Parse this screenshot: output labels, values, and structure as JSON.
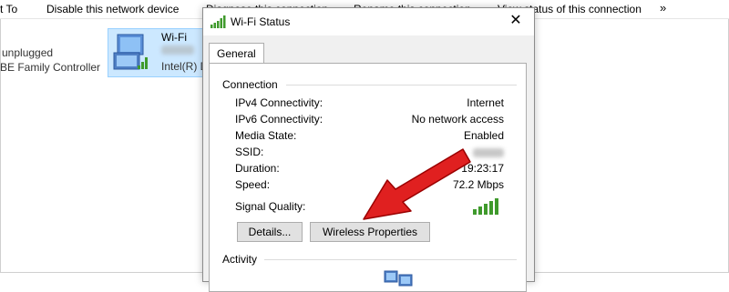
{
  "toolbar": {
    "items": [
      "t To",
      "Disable this network device",
      "Diagnose this connection",
      "Rename this connection",
      "View status of this connection"
    ],
    "more": "»"
  },
  "background": {
    "adapter_left": {
      "status": "unplugged",
      "device": "BE Family Controller"
    },
    "wifi_adapter": {
      "name": "Wi-Fi",
      "device": "Intel(R) D"
    }
  },
  "dialog": {
    "title": "Wi-Fi Status",
    "close": "✕",
    "tab": "General",
    "connection": {
      "label": "Connection",
      "rows": [
        {
          "label": "IPv4 Connectivity:",
          "value": "Internet"
        },
        {
          "label": "IPv6 Connectivity:",
          "value": "No network access"
        },
        {
          "label": "Media State:",
          "value": "Enabled"
        },
        {
          "label": "SSID:",
          "value": ""
        },
        {
          "label": "Duration:",
          "value": "19:23:17"
        },
        {
          "label": "Speed:",
          "value": "72.2 Mbps"
        },
        {
          "label": "Signal Quality:",
          "value": ""
        }
      ]
    },
    "buttons": {
      "details": "Details...",
      "wireless_properties": "Wireless Properties"
    },
    "activity": {
      "label": "Activity"
    }
  },
  "colors": {
    "arrow": "#e02020",
    "signal": "#3f9a2c",
    "selection": "#cce8ff"
  }
}
